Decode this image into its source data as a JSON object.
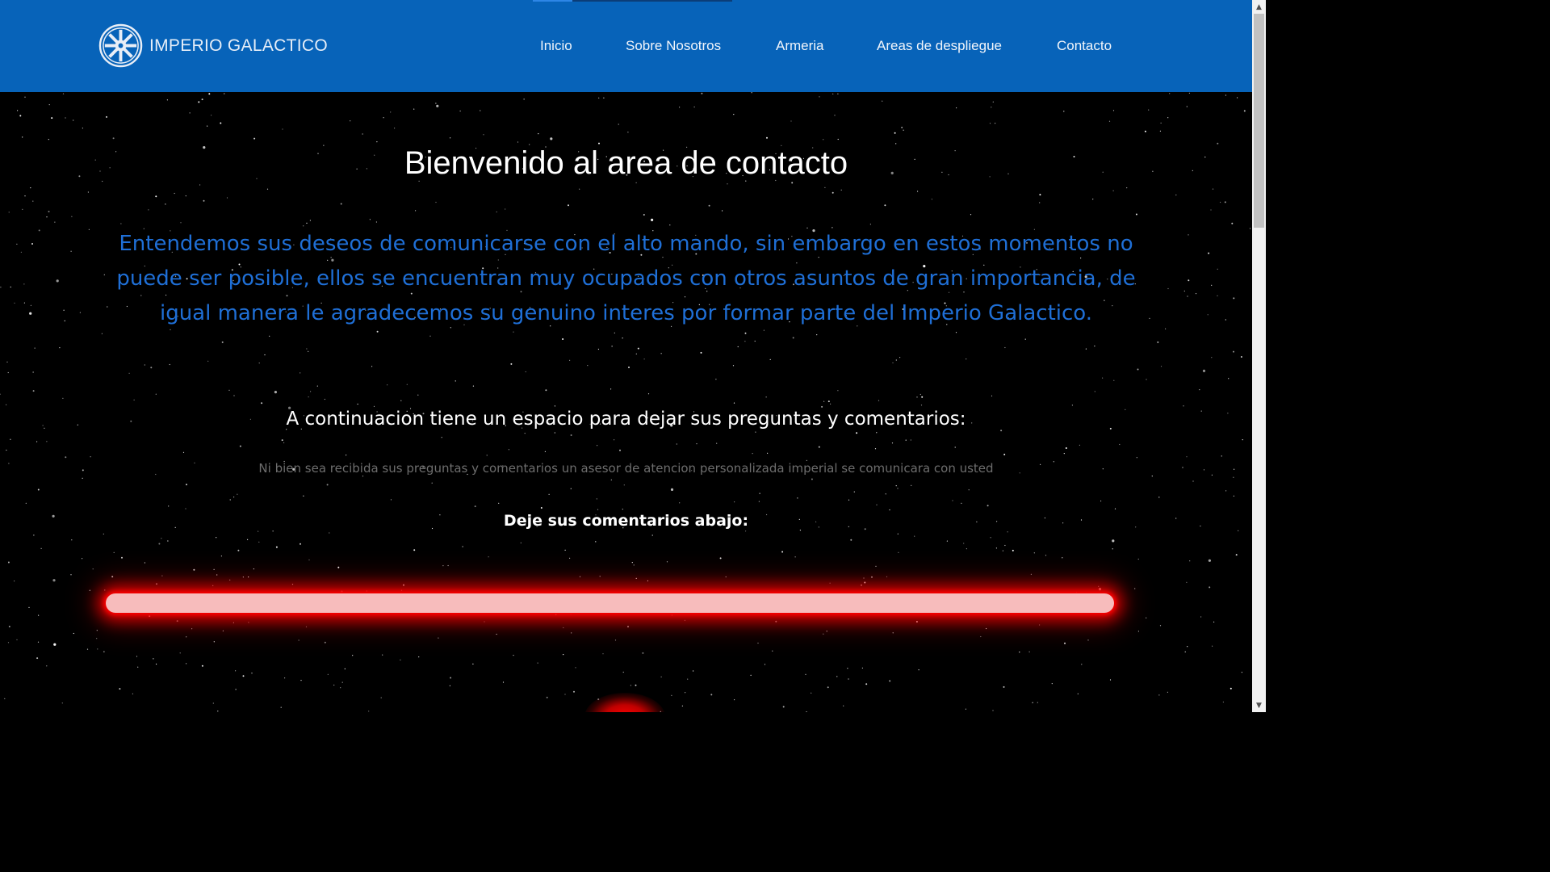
{
  "header": {
    "brand_name": "IMPERIO GALACTICO",
    "logo_icon": "imperial-crest-icon",
    "nav": [
      {
        "label": "Inicio"
      },
      {
        "label": "Sobre Nosotros"
      },
      {
        "label": "Armeria"
      },
      {
        "label": "Areas de despliegue"
      },
      {
        "label": "Contacto"
      }
    ]
  },
  "main": {
    "title": "Bienvenido al area de contacto",
    "lead": "Entendemos sus deseos de comunicarse con el alto mando, sin embargo en estos momentos no puede ser posible, ellos se encuentran muy ocupados con otros asuntos de gran importancia, de igual manera le agradecemos su genuino interes por formar parte del Imperio Galactico.",
    "subtitle": "A continuacion tiene un espacio para dejar sus preguntas y comentarios:",
    "note": "Ni bien sea recibida sus preguntas y comentarios un asesor de atencion personalizada imperial se comunicara con usted",
    "comment_label": "Deje sus comentarios abajo:",
    "comment_input": {
      "value": "",
      "placeholder": ""
    }
  },
  "colors": {
    "navbar": "#0763b9",
    "lead_text": "#1f6fd6",
    "saber_core": "#f7bcbc",
    "saber_glow": "#ff0000",
    "background": "#000000"
  },
  "scrollbar": {
    "up_icon": "scroll-up-arrow-icon",
    "down_icon": "scroll-down-arrow-icon"
  }
}
